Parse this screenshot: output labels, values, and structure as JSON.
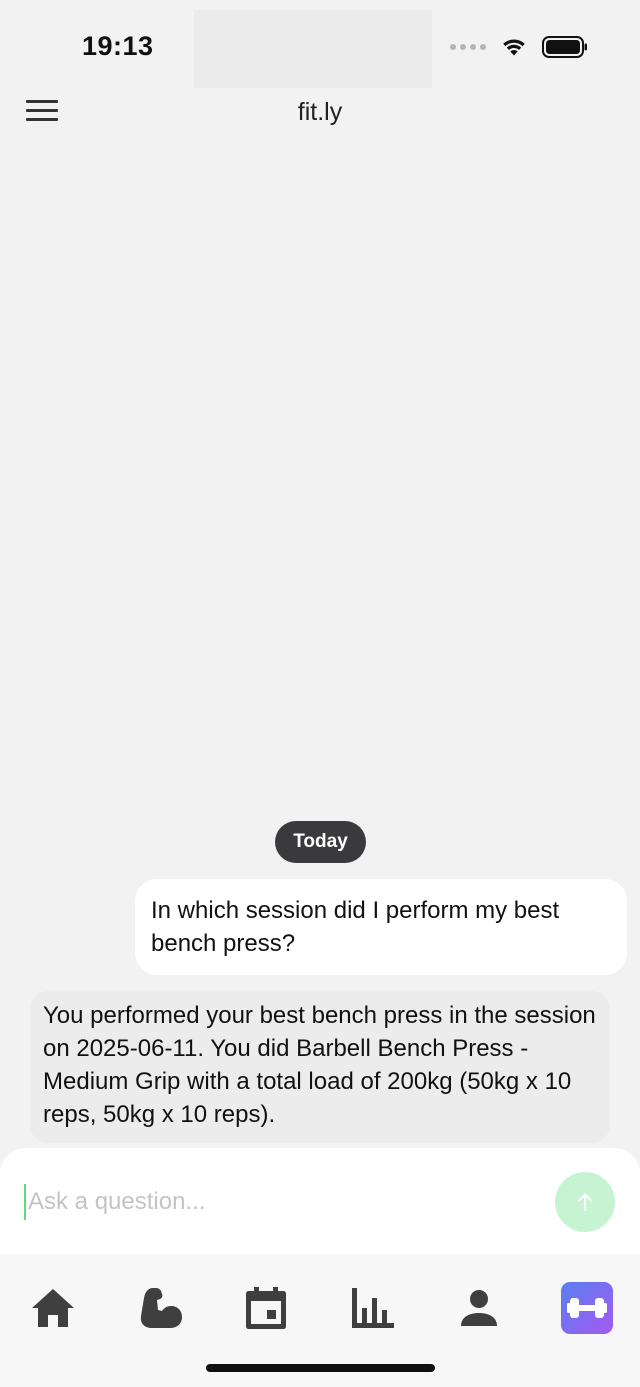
{
  "status_bar": {
    "time": "19:13"
  },
  "header": {
    "title": "fit.ly"
  },
  "chat": {
    "date_label": "Today",
    "messages": [
      {
        "role": "user",
        "text": "In which session did I perform my best bench press?"
      },
      {
        "role": "assistant",
        "text": "You performed your best bench press in the session on 2025-06-11. You did Barbell Bench Press - Medium Grip with a total load of 200kg (50kg x 10 reps, 50kg x 10 reps)."
      }
    ]
  },
  "composer": {
    "placeholder": "Ask a question...",
    "value": ""
  },
  "tab_bar": {
    "items": [
      {
        "icon": "home-icon"
      },
      {
        "icon": "flexed-arm-icon"
      },
      {
        "icon": "calendar-icon"
      },
      {
        "icon": "bar-chart-icon"
      },
      {
        "icon": "person-icon"
      },
      {
        "icon": "dumbbell-icon",
        "active": true
      }
    ]
  },
  "colors": {
    "send_button": "#c6f3d2",
    "date_pill": "#3a3a3c",
    "active_tab_gradient_start": "#5a7ff0",
    "active_tab_gradient_end": "#a35af0"
  }
}
